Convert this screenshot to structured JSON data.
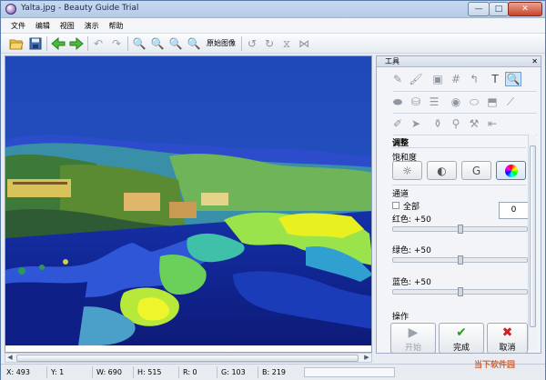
{
  "window": {
    "title": "Yalta.jpg - Beauty Guide Trial",
    "controls": {
      "minimize": "—",
      "maximize": "□",
      "close": "✕"
    }
  },
  "menu": {
    "items": [
      "文件",
      "编辑",
      "视图",
      "演示",
      "帮助"
    ]
  },
  "toolbar": {
    "original_image_label": "原始图像",
    "icons": [
      "open-folder-icon",
      "save-icon",
      "back-arrow-icon",
      "forward-arrow-icon",
      "undo-icon",
      "redo-icon",
      "zoom-in-icon",
      "zoom-out-icon",
      "zoom-fit-icon",
      "zoom-actual-icon",
      "rotate-left-icon",
      "rotate-right-icon",
      "flip-vertical-icon",
      "flip-horizontal-icon"
    ]
  },
  "panel": {
    "title": "工具",
    "close": "✕",
    "section_adjust": "调整",
    "saturation_label": "饱和度",
    "saturation_buttons": [
      "☼",
      "◐",
      "G",
      "wheel"
    ],
    "channel_label": "通道",
    "all_label": "全部",
    "all_value": "0",
    "red_label": "红色: +50",
    "green_label": "绿色: +50",
    "blue_label": "蓝色: +50",
    "red_level": 0.5,
    "green_level": 0.5,
    "blue_level": 0.5,
    "operation_label": "操作",
    "start_label": "开始",
    "done_label": "完成",
    "cancel_label": "取消"
  },
  "status": {
    "x": "X: 493",
    "y": "Y: 1",
    "w": "W: 690",
    "h": "H: 515",
    "r": "R: 0",
    "g": "G: 103",
    "b": "B: 219"
  },
  "watermark": "当下软件园",
  "colors": {
    "accent": "#4a7fbd",
    "water": "#1a2fa8",
    "foam": "#e8f020"
  }
}
